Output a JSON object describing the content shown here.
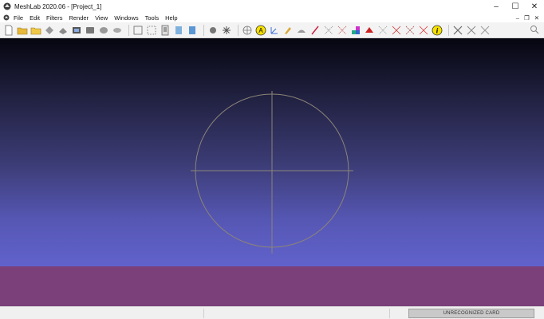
{
  "window": {
    "title": "MeshLab 2020.06 - [Project_1]",
    "minimize": "–",
    "maximize": "☐",
    "close": "✕"
  },
  "menu": {
    "items": [
      "File",
      "Edit",
      "Filters",
      "Render",
      "View",
      "Windows",
      "Tools",
      "Help"
    ],
    "mdi": {
      "minimize": "–",
      "restore": "❐",
      "close": "✕"
    }
  },
  "toolbar": {
    "icons": [
      "new-project-icon",
      "open-project-icon",
      "open-mesh-icon",
      "reload-icon",
      "import-icon",
      "save-snapshot-icon",
      "layer-icon",
      "layer-stack-icon",
      "bounding-box-icon",
      "points-icon",
      "wireframe-icon",
      "info-doc-icon",
      "flat-shading-icon",
      "smooth-shading-icon",
      "trackball-icon",
      "light-icon",
      "align-icon",
      "annotation-a-icon",
      "axis-icon",
      "paint-icon",
      "measure-icon",
      "brush-icon",
      "pick-points-icon",
      "select-vertices-icon",
      "color-icon",
      "select-faces-icon",
      "select-connected-icon",
      "move-icon",
      "edit-icon",
      "z-paint-icon",
      "info-icon",
      "close-tools-icon",
      "scissors-icon",
      "cut-icon"
    ],
    "search_icon": "search-icon"
  },
  "colors": {
    "viewport_top": "#060610",
    "viewport_bottom": "#6162cc",
    "lower_panel": "#7b4079",
    "trackball": "#8c8478"
  },
  "status": {
    "card": "UNRECOGNIZED CARD"
  }
}
